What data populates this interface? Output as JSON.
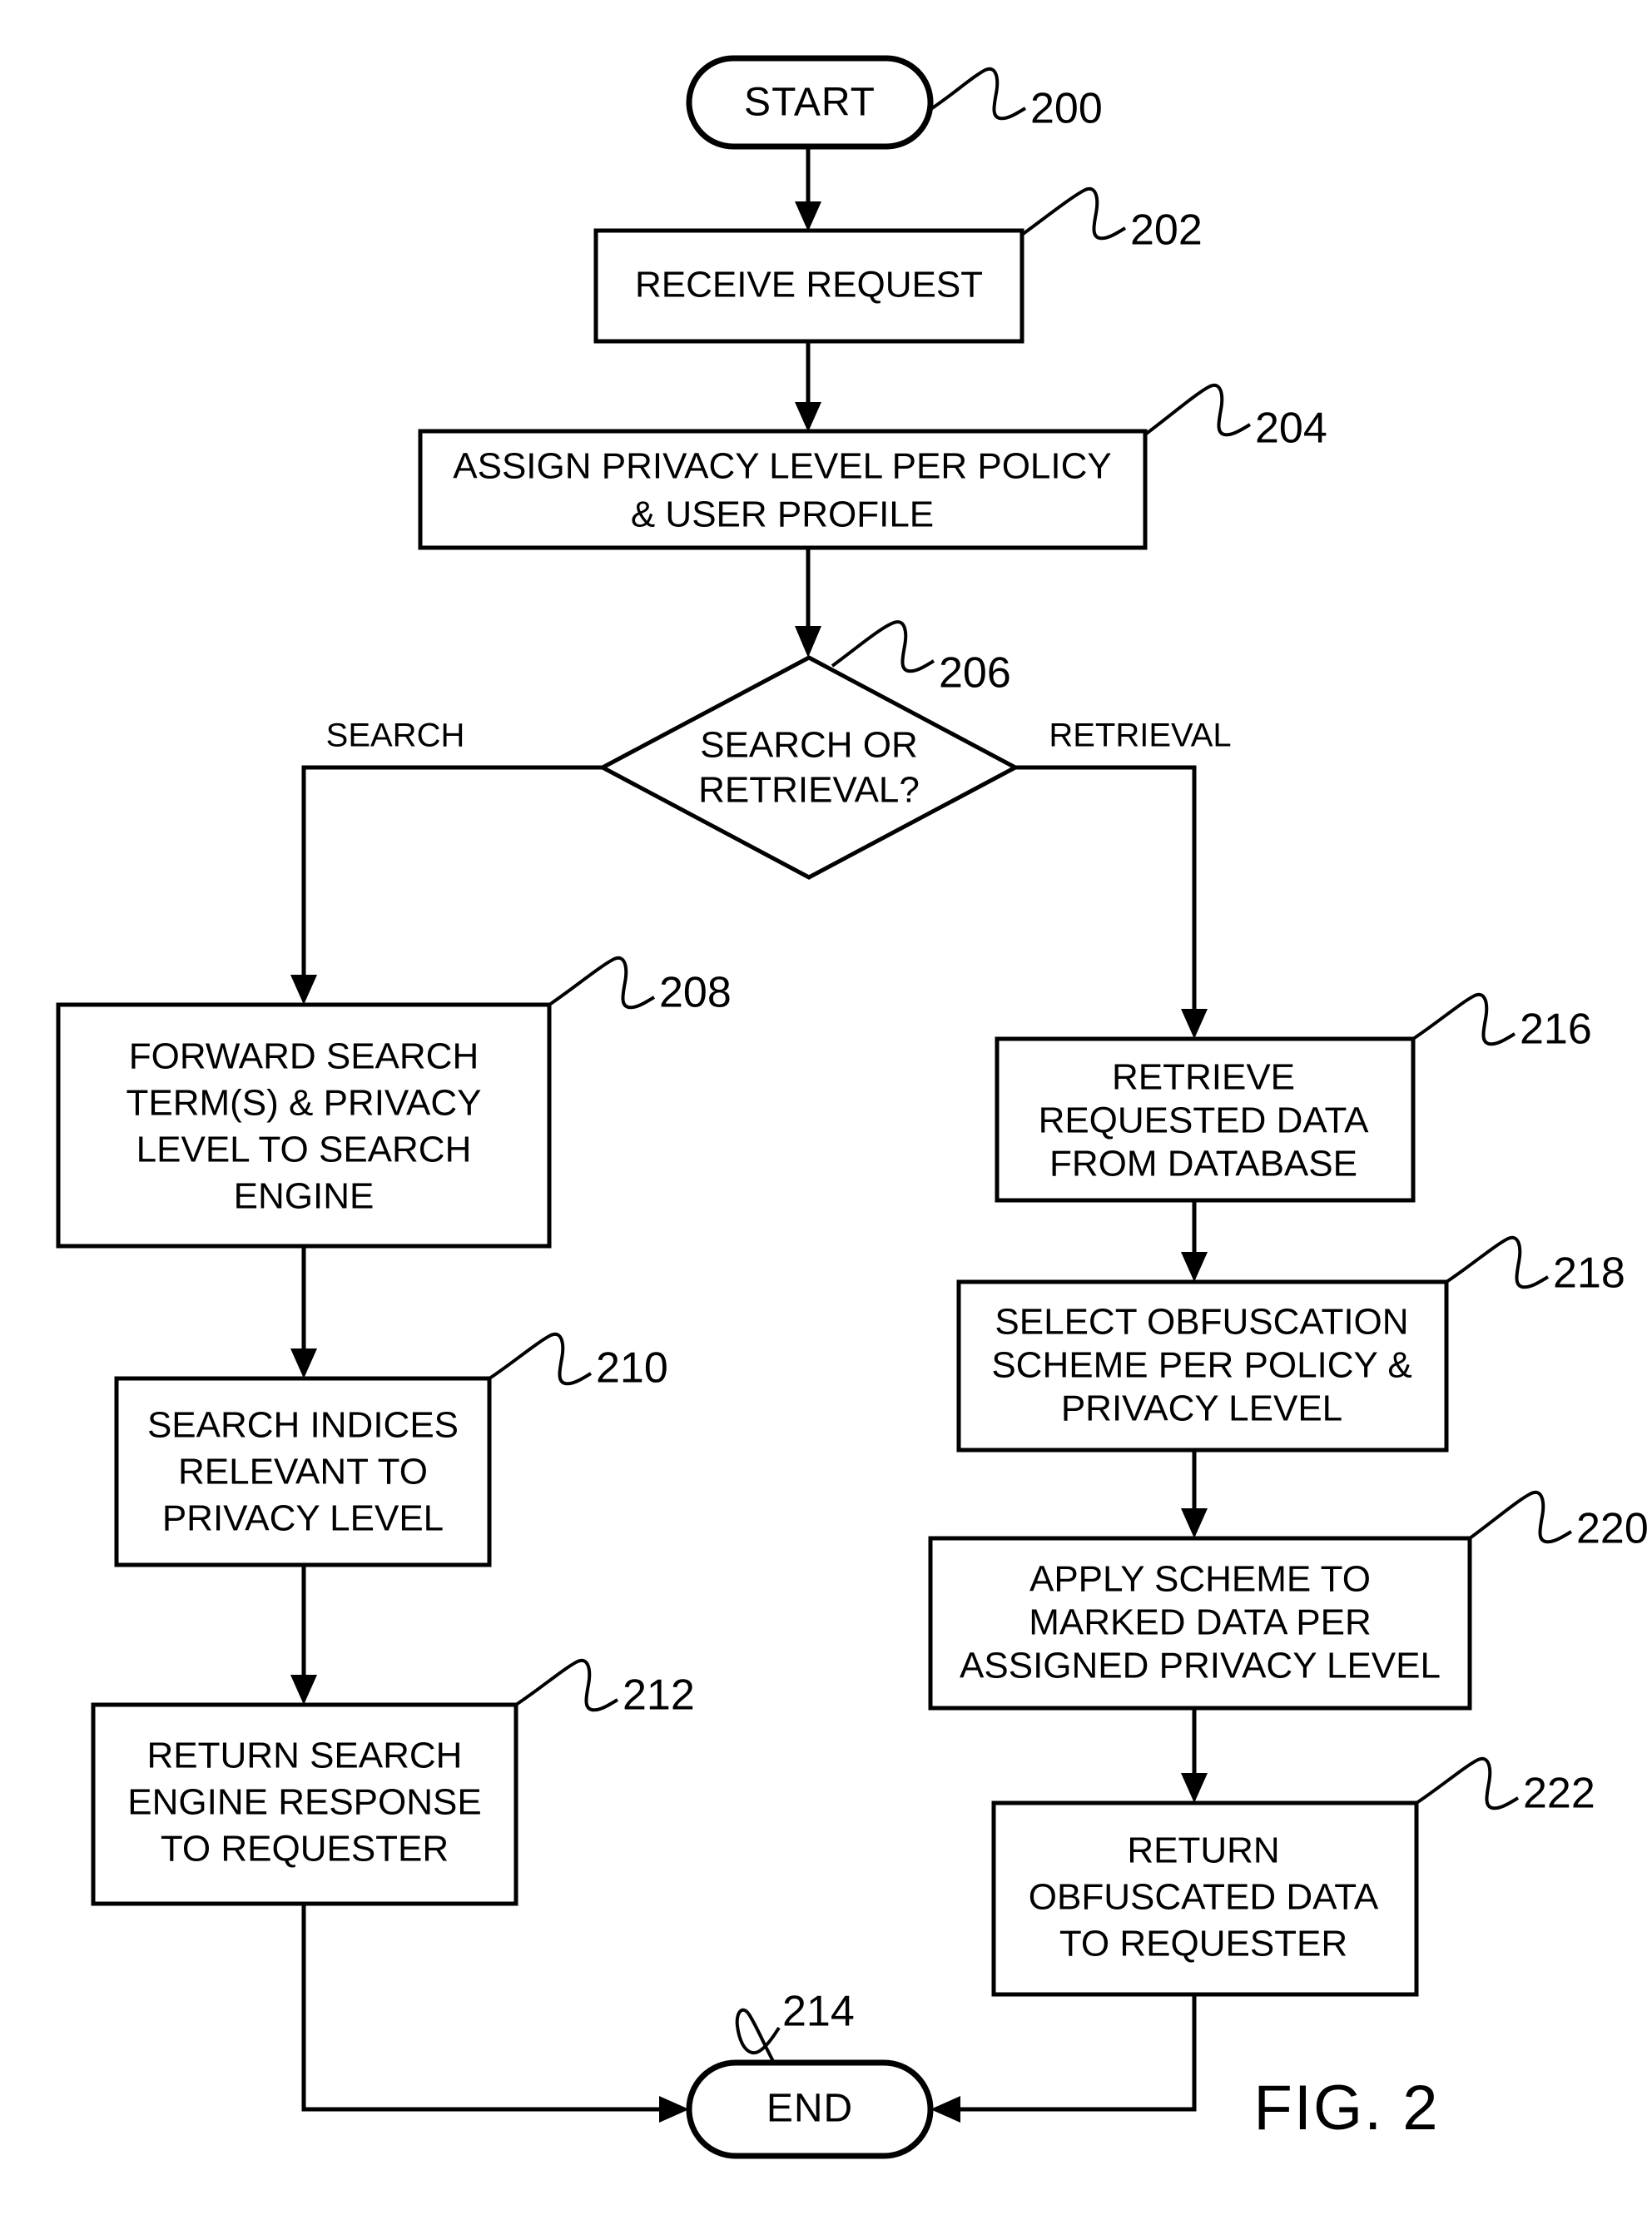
{
  "figure": {
    "caption": "FIG. 2",
    "title": "Privacy level assignment and obfuscation process flowchart"
  },
  "nodes": [
    {
      "id": "start",
      "ref": "200",
      "shape": "terminal",
      "lines": [
        "START"
      ]
    },
    {
      "id": "receive_request",
      "ref": "202",
      "shape": "process",
      "lines": [
        "RECEIVE REQUEST"
      ]
    },
    {
      "id": "assign_privacy_level",
      "ref": "204",
      "shape": "process",
      "lines": [
        "ASSIGN PRIVACY LEVEL PER POLICY",
        "& USER PROFILE"
      ]
    },
    {
      "id": "search_or_retrieval",
      "ref": "206",
      "shape": "decision",
      "lines": [
        "SEARCH OR",
        "RETRIEVAL?"
      ]
    },
    {
      "id": "forward_search_terms",
      "ref": "208",
      "shape": "process",
      "lines": [
        "FORWARD SEARCH",
        "TERM(S) & PRIVACY",
        "LEVEL TO SEARCH",
        "ENGINE"
      ]
    },
    {
      "id": "search_indices",
      "ref": "210",
      "shape": "process",
      "lines": [
        "SEARCH INDICES",
        "RELEVANT TO",
        "PRIVACY LEVEL"
      ]
    },
    {
      "id": "return_search_response",
      "ref": "212",
      "shape": "process",
      "lines": [
        "RETURN SEARCH",
        "ENGINE RESPONSE",
        "TO REQUESTER"
      ]
    },
    {
      "id": "end",
      "ref": "214",
      "shape": "terminal",
      "lines": [
        "END"
      ]
    },
    {
      "id": "retrieve_data",
      "ref": "216",
      "shape": "process",
      "lines": [
        "RETRIEVE",
        "REQUESTED DATA",
        "FROM DATABASE"
      ]
    },
    {
      "id": "select_obfuscation_scheme",
      "ref": "218",
      "shape": "process",
      "lines": [
        "SELECT OBFUSCATION",
        "SCHEME PER POLICY &",
        "PRIVACY LEVEL"
      ]
    },
    {
      "id": "apply_scheme",
      "ref": "220",
      "shape": "process",
      "lines": [
        "APPLY SCHEME TO",
        "MARKED DATA PER",
        "ASSIGNED PRIVACY LEVEL"
      ]
    },
    {
      "id": "return_obfuscated_data",
      "ref": "222",
      "shape": "process",
      "lines": [
        "RETURN",
        "OBFUSCATED DATA",
        "TO REQUESTER"
      ]
    }
  ],
  "branch_labels": {
    "left": "SEARCH",
    "right": "RETRIEVAL"
  },
  "text": {
    "n200_l0": "START",
    "n202_l0": "RECEIVE REQUEST",
    "n204_l0": "ASSIGN PRIVACY LEVEL PER POLICY",
    "n204_l1": "& USER PROFILE",
    "n206_l0": "SEARCH OR",
    "n206_l1": "RETRIEVAL?",
    "n208_l0": "FORWARD SEARCH",
    "n208_l1": "TERM(S) & PRIVACY",
    "n208_l2": "LEVEL TO SEARCH",
    "n208_l3": "ENGINE",
    "n210_l0": "SEARCH INDICES",
    "n210_l1": "RELEVANT TO",
    "n210_l2": "PRIVACY LEVEL",
    "n212_l0": "RETURN SEARCH",
    "n212_l1": "ENGINE RESPONSE",
    "n212_l2": "TO REQUESTER",
    "n214_l0": "END",
    "n216_l0": "RETRIEVE",
    "n216_l1": "REQUESTED DATA",
    "n216_l2": "FROM DATABASE",
    "n218_l0": "SELECT OBFUSCATION",
    "n218_l1": "SCHEME PER POLICY &",
    "n218_l2": "PRIVACY LEVEL",
    "n220_l0": "APPLY SCHEME TO",
    "n220_l1": "MARKED DATA PER",
    "n220_l2": "ASSIGNED PRIVACY LEVEL",
    "n222_l0": "RETURN",
    "n222_l1": "OBFUSCATED DATA",
    "n222_l2": "TO REQUESTER"
  },
  "refs": {
    "r200": "200",
    "r202": "202",
    "r204": "204",
    "r206": "206",
    "r208": "208",
    "r210": "210",
    "r212": "212",
    "r214": "214",
    "r216": "216",
    "r218": "218",
    "r220": "220",
    "r222": "222"
  },
  "colors": {
    "line": "#000000",
    "fill": "#ffffff",
    "text": "#000000"
  }
}
